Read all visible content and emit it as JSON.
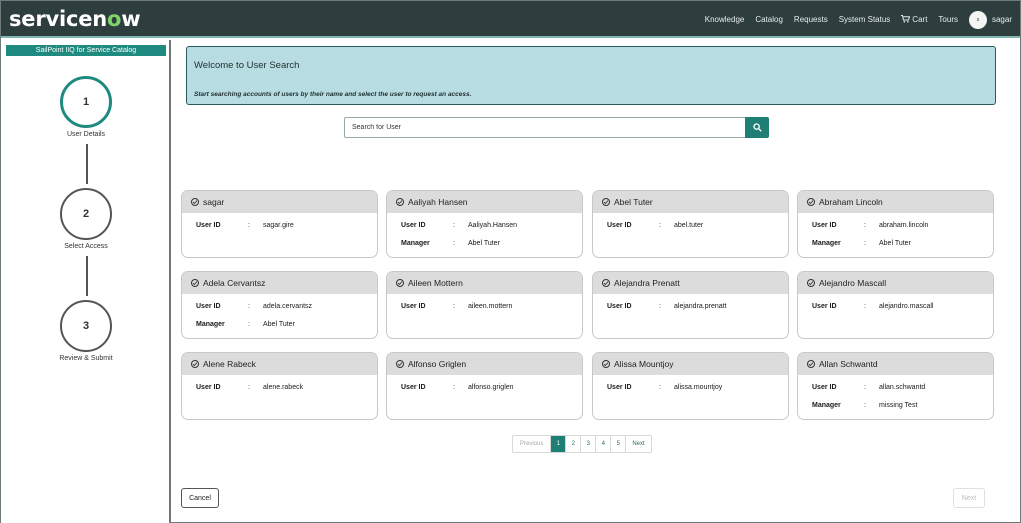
{
  "header": {
    "logo_prefix": "servicen",
    "logo_o": "o",
    "logo_suffix": "w",
    "nav": [
      "Knowledge",
      "Catalog",
      "Requests",
      "System Status",
      "Cart",
      "Tours"
    ],
    "avatar_initial": "s",
    "user": "sagar",
    "colors": {
      "bar": "#2e3d3d",
      "logo_accent": "#7fd36a"
    }
  },
  "sidebar": {
    "title": "SailPoint IIQ for Service Catalog",
    "steps": [
      {
        "number": "1",
        "label": "User Details"
      },
      {
        "number": "2",
        "label": "Select Access"
      },
      {
        "number": "3",
        "label": "Review & Submit"
      }
    ]
  },
  "welcome": {
    "title": "Welcome to User Search",
    "subtitle": "Start searching accounts of users by their name and select the user to request an access."
  },
  "search": {
    "placeholder": "Search for User",
    "icon": "search-icon"
  },
  "cards": [
    {
      "name": "sagar",
      "user_id": "sagar.gire",
      "manager": null
    },
    {
      "name": "Aaliyah Hansen",
      "user_id": "Aaliyah.Hansen",
      "manager": "Abel Tuter"
    },
    {
      "name": "Abel Tuter",
      "user_id": "abel.tuter",
      "manager": null
    },
    {
      "name": "Abraham Lincoln",
      "user_id": "abraham.lincoln",
      "manager": "Abel Tuter"
    },
    {
      "name": "Adela Cervantsz",
      "user_id": "adela.cervantsz",
      "manager": "Abel Tuter"
    },
    {
      "name": "Aileen Mottern",
      "user_id": "aileen.mottern",
      "manager": null
    },
    {
      "name": "Alejandra Prenatt",
      "user_id": "alejandra.prenatt",
      "manager": null
    },
    {
      "name": "Alejandro Mascall",
      "user_id": "alejandro.mascall",
      "manager": null
    },
    {
      "name": "Alene Rabeck",
      "user_id": "alene.rabeck",
      "manager": null
    },
    {
      "name": "Alfonso Griglen",
      "user_id": "alfonso.griglen",
      "manager": null
    },
    {
      "name": "Alissa Mountjoy",
      "user_id": "alissa.mountjoy",
      "manager": null
    },
    {
      "name": "Allan Schwantd",
      "user_id": "allan.schwantd",
      "manager": "missing Test"
    }
  ],
  "labels": {
    "user_id": "User ID",
    "manager": "Manager",
    "colon": ":"
  },
  "pagination": {
    "previous": "Previous",
    "pages": [
      "1",
      "2",
      "3",
      "4",
      "5"
    ],
    "current": "1",
    "next": "Next"
  },
  "footer": {
    "cancel": "Cancel",
    "next": "Next"
  }
}
